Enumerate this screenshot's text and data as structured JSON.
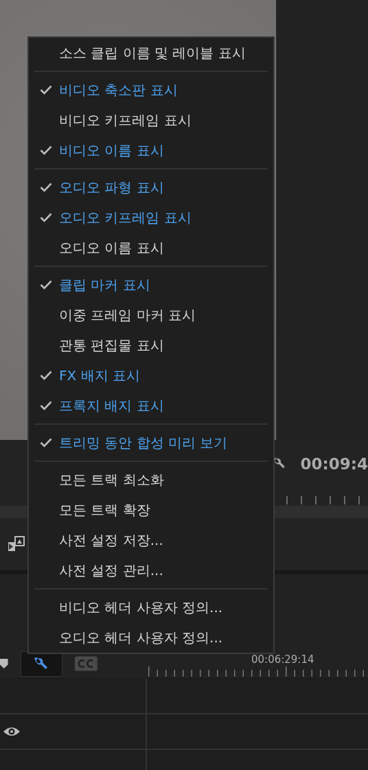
{
  "program_monitor": {
    "timecode": "00:09:4"
  },
  "timeline": {
    "settings_button": {
      "selected": true
    },
    "ruler_times": [
      "00:06:29:14"
    ]
  },
  "context_menu": {
    "sections": [
      [
        {
          "label": "소스 클립 이름 및 레이블 표시",
          "checked": false
        }
      ],
      [
        {
          "label": "비디오 축소판 표시",
          "checked": true
        },
        {
          "label": "비디오 키프레임 표시",
          "checked": false
        },
        {
          "label": "비디오 이름 표시",
          "checked": true
        }
      ],
      [
        {
          "label": "오디오 파형 표시",
          "checked": true
        },
        {
          "label": "오디오 키프레임 표시",
          "checked": true
        },
        {
          "label": "오디오 이름 표시",
          "checked": false
        }
      ],
      [
        {
          "label": "클립 마커 표시",
          "checked": true
        },
        {
          "label": "이중 프레임 마커 표시",
          "checked": false
        },
        {
          "label": "관통 편집물 표시",
          "checked": false
        },
        {
          "label": "FX 배지 표시",
          "checked": true
        },
        {
          "label": "프록지 배지 표시",
          "checked": true
        }
      ],
      [
        {
          "label": "트리밍 동안 합성 미리 보기",
          "checked": true
        }
      ],
      [
        {
          "label": "모든 트랙 최소화",
          "checked": false
        },
        {
          "label": "모든 트랙 확장",
          "checked": false
        },
        {
          "label": "사전 설정 저장...",
          "checked": false
        },
        {
          "label": "사전 설정 관리...",
          "checked": false
        }
      ],
      [
        {
          "label": "비디오 헤더 사용자 정의...",
          "checked": false
        },
        {
          "label": "오디오 헤더 사용자 정의...",
          "checked": false
        }
      ]
    ]
  }
}
